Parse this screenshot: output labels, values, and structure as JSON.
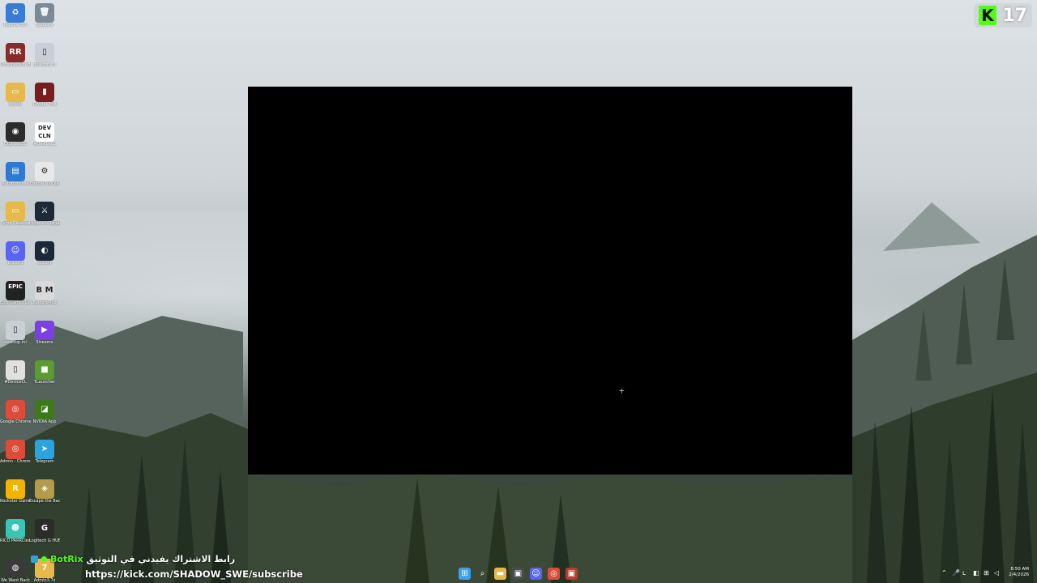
{
  "desktop": {
    "icons": [
      {
        "label": "Recycle Bin",
        "glyph": "♻",
        "color": "#3a7bd5"
      },
      {
        "label": "gadoara",
        "glyph": "🗑",
        "color": "#7b8a99"
      },
      {
        "label": "Crosshaired editor",
        "glyph": "RR",
        "color": "#8a2b2b"
      },
      {
        "label": "desktop.ini",
        "glyph": "▯",
        "color": "#c9cfd4"
      },
      {
        "label": "Nitkoli",
        "glyph": "▭",
        "color": "#e7b84a"
      },
      {
        "label": "Crystal Tool",
        "glyph": "▮",
        "color": "#7a1d1d"
      },
      {
        "label": "OBS Studio",
        "glyph": "◉",
        "color": "#2b2b2b"
      },
      {
        "label": "#DeviceCL",
        "glyph": "DEV CLN",
        "color": "#ffffff"
      },
      {
        "label": "Autoruns.exe",
        "glyph": "▤",
        "color": "#2e7ad1"
      },
      {
        "label": "Enable NVIDIA",
        "glyph": "⚙",
        "color": "#e8e8e8"
      },
      {
        "label": "Temp Cleanup",
        "glyph": "▭",
        "color": "#e7b84a"
      },
      {
        "label": "Hogwarts Legacy",
        "glyph": "⚔",
        "color": "#1d2a35"
      },
      {
        "label": "Discord",
        "glyph": "☺",
        "color": "#5865f2"
      },
      {
        "label": "Steam",
        "glyph": "◐",
        "color": "#1b2838"
      },
      {
        "label": "Epic Games Launcher",
        "glyph": "EPIC",
        "color": "#222222"
      },
      {
        "label": "BaldersMod",
        "glyph": "B M",
        "color": "#d9d9d9"
      },
      {
        "label": "desktop.ini",
        "glyph": "▯",
        "color": "#c9cfd4"
      },
      {
        "label": "Streamo",
        "glyph": "▶",
        "color": "#7b3fe4"
      },
      {
        "label": "#DeviceCL",
        "glyph": "▯",
        "color": "#e0e0e0"
      },
      {
        "label": "TLauncher",
        "glyph": "■",
        "color": "#5a9c2f"
      },
      {
        "label": "Google Chrome",
        "glyph": "◎",
        "color": "#dd4b39"
      },
      {
        "label": "NVIDIA App",
        "glyph": "◪",
        "color": "#3d7a1a"
      },
      {
        "label": "Admin - Chrome",
        "glyph": "◎",
        "color": "#dd4b39"
      },
      {
        "label": "Telegram",
        "glyph": "➤",
        "color": "#2aa3df"
      },
      {
        "label": "Rockstar Games ...",
        "glyph": "R",
        "color": "#f1b400"
      },
      {
        "label": "Escape the Backrooms",
        "glyph": "◈",
        "color": "#b49a4a"
      },
      {
        "label": "RICO PARRCless",
        "glyph": "☻",
        "color": "#39c4b4"
      },
      {
        "label": "Logitech G HUB",
        "glyph": "G",
        "color": "#2b2b2b"
      },
      {
        "label": "We Want Back",
        "glyph": "◍",
        "color": "#3a3a3a"
      },
      {
        "label": "Admin3.7z",
        "glyph": "7",
        "color": "#e7b84a"
      }
    ]
  },
  "window": {
    "crosshair": "+"
  },
  "kick": {
    "logo": "K",
    "viewer_count": "17",
    "color": "#53fc18"
  },
  "chat": {
    "username": "BotRix",
    "message": "رابط الاشتراك يفيدني في التوثيق",
    "link": "https://kick.com/SHADOW_SWE/subscribe"
  },
  "taskbar": {
    "apps": [
      {
        "name": "start-icon",
        "glyph": "⊞",
        "color": "#3aa0f3"
      },
      {
        "name": "search-icon",
        "glyph": "⌕",
        "color": "transparent"
      },
      {
        "name": "file-explorer-icon",
        "glyph": "▬",
        "color": "#e7b84a"
      },
      {
        "name": "store-icon",
        "glyph": "▣",
        "color": "#4a4a4a"
      },
      {
        "name": "discord-icon",
        "glyph": "☺",
        "color": "#5865f2"
      },
      {
        "name": "chrome-icon",
        "glyph": "◎",
        "color": "#dd4b39"
      },
      {
        "name": "active-app-icon",
        "glyph": "▣",
        "color": "#c0392b"
      }
    ],
    "tray": [
      "⌃",
      "🎤",
      "ʟ",
      "◧",
      "⊞",
      "◁"
    ],
    "time": "8:50 AM",
    "date": "2/4/2026"
  }
}
